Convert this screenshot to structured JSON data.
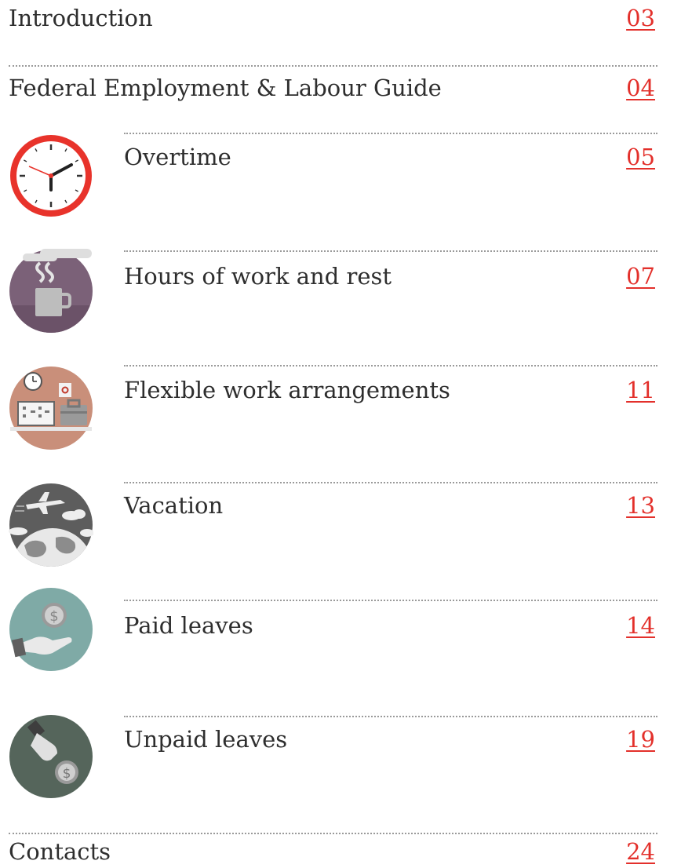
{
  "toc": {
    "introduction": {
      "title": "Introduction",
      "page": "03"
    },
    "federal": {
      "title": "Federal Employment & Labour Guide",
      "page": "04"
    },
    "sections": [
      {
        "title": "Overtime",
        "page": "05",
        "icon": "clock-icon"
      },
      {
        "title": "Hours of work and rest",
        "page": "07",
        "icon": "coffee-cup-icon"
      },
      {
        "title": "Flexible work arrangements",
        "page": "11",
        "icon": "workspace-icon"
      },
      {
        "title": "Vacation",
        "page": "13",
        "icon": "airplane-globe-icon"
      },
      {
        "title": "Paid leaves",
        "page": "14",
        "icon": "hand-coin-icon"
      },
      {
        "title": "Unpaid leaves",
        "page": "19",
        "icon": "hand-dropping-coin-icon"
      }
    ],
    "contacts": {
      "title": "Contacts",
      "page": "24"
    }
  },
  "colors": {
    "link": "#e3302b",
    "clock_rim": "#e8332b",
    "cup_bg": "#7b6178",
    "workspace_bg": "#c98f7a",
    "vacation_bg": "#5d5d5d",
    "paid_bg": "#7faaa6",
    "unpaid_bg": "#55655b"
  }
}
